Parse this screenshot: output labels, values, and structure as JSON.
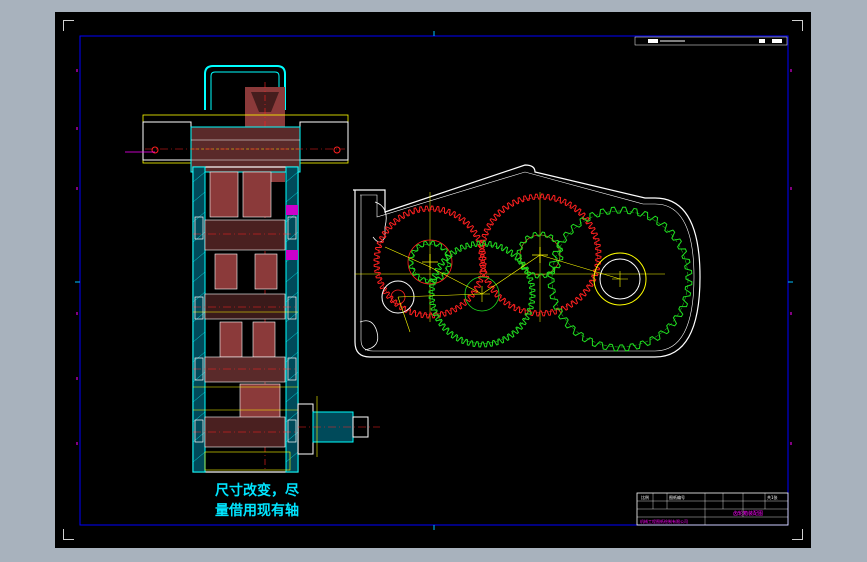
{
  "drawing": {
    "note_line1": "尺寸改变，尽",
    "note_line2": "量借用现有轴",
    "title_block": {
      "header_left": "比例",
      "header_mid": "图纸编号",
      "drawing_name": "齿轮箱装配图",
      "company": "机械工程图纸绘制有限公司",
      "sheet": "共1张"
    }
  },
  "colors": {
    "background": "#000000",
    "frame": "#0000ff",
    "gear_red": "#ff2020",
    "gear_green": "#20e020",
    "section_cyan": "#00ffff",
    "hatch_red": "#8b3a3a",
    "accent_magenta": "#ff00ff",
    "dim_yellow": "#ffff00",
    "housing_white": "#ffffff"
  }
}
